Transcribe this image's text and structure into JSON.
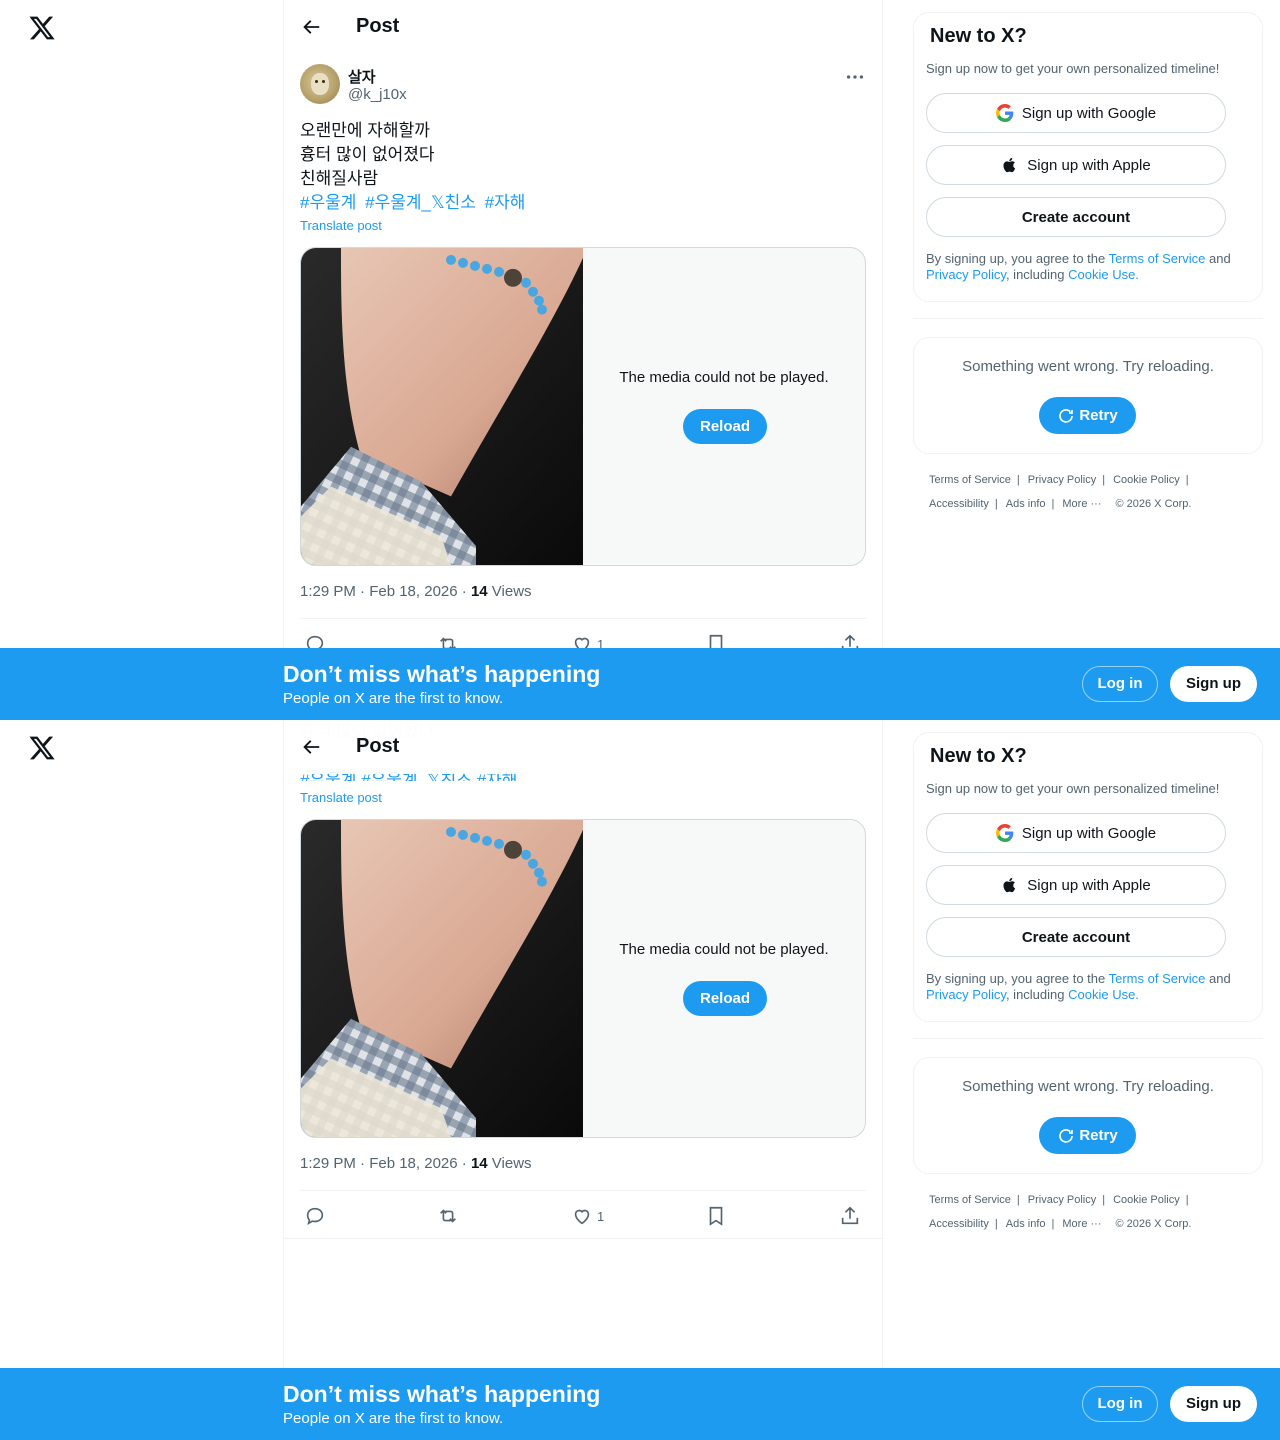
{
  "nav": {
    "logo_icon": "x-logo-icon",
    "back_icon": "arrow-left-icon",
    "page_title": "Post"
  },
  "post": {
    "display_name": "살자",
    "handle": "@k_j10x",
    "lines": [
      "오랜만에 자해할까",
      "흉터 많이 없어졌다",
      "친해질사람"
    ],
    "hashtags": [
      "#우울계",
      "#우울계_𝕏친소",
      "#자해"
    ],
    "translate_label": "Translate post",
    "media_error": "The media could not be played.",
    "reload_label": "Reload",
    "time": "1:29 PM · Feb 18, 2026 · ",
    "views_count": "14",
    "views_label": " Views",
    "like_count": "1"
  },
  "signup": {
    "title": "New to X?",
    "subtitle": "Sign up now to get your own personalized timeline!",
    "google_label": "Sign up with Google",
    "apple_label": "Sign up with Apple",
    "create_label": "Create account",
    "legal_1": "By signing up, you agree to the ",
    "legal_tos": "Terms of Service",
    "legal_2": " and ",
    "legal_privacy": "Privacy Policy",
    "legal_3": ", including ",
    "legal_cookie": "Cookie Use."
  },
  "trends_error": {
    "message": "Something went wrong. Try reloading.",
    "retry_label": "Retry"
  },
  "footer": {
    "terms": "Terms of Service",
    "privacy": "Privacy Policy",
    "cookie": "Cookie Policy",
    "accessibility": "Accessibility",
    "ads": "Ads info",
    "more": "More ···",
    "copyright": "© 2026 X Corp."
  },
  "banner": {
    "title": "Don’t miss what’s happening",
    "subtitle": "People on X are the first to know.",
    "login_label": "Log in",
    "signup_label": "Sign up"
  },
  "colors": {
    "accent": "#1d9bf0",
    "text": "#0f1419",
    "muted": "#536471",
    "border": "#cfd9de"
  }
}
